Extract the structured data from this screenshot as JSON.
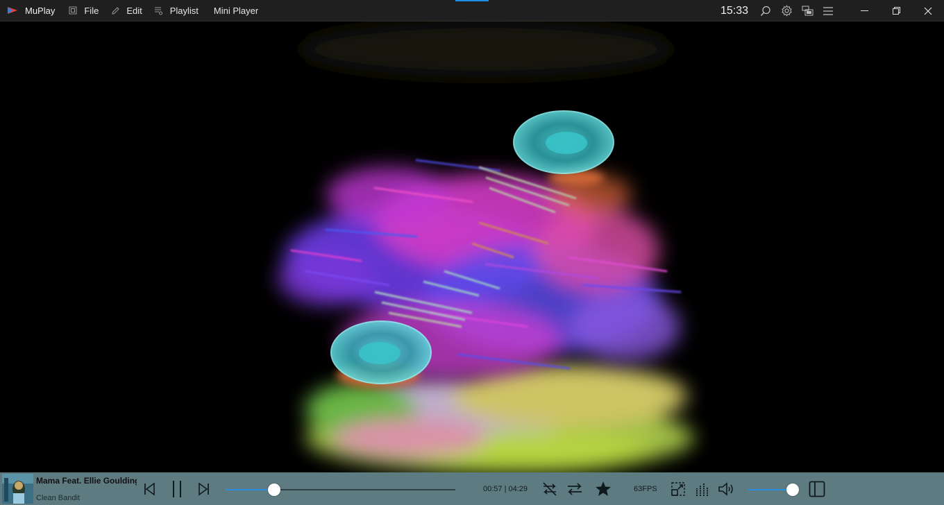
{
  "app": {
    "name": "MuPlay"
  },
  "menu": {
    "file": "File",
    "edit": "Edit",
    "playlist": "Playlist",
    "mini_player": "Mini Player"
  },
  "titlebar": {
    "clock": "15:33",
    "icons": [
      "search-icon",
      "gear-icon",
      "display-icon",
      "hamburger-icon"
    ],
    "window_buttons": [
      "minimize-icon",
      "restore-icon",
      "close-icon"
    ]
  },
  "track": {
    "title": "Mama Feat. Ellie Goulding",
    "artist": "Clean Bandit"
  },
  "playback": {
    "time_display": "00:57 | 04:29",
    "progress": 0.212,
    "fps": "63FPS",
    "volume": 1.0
  },
  "colors": {
    "accent": "#1e8de6",
    "player_bar": "#5f7b82",
    "titlebar": "#1f1f1f"
  }
}
